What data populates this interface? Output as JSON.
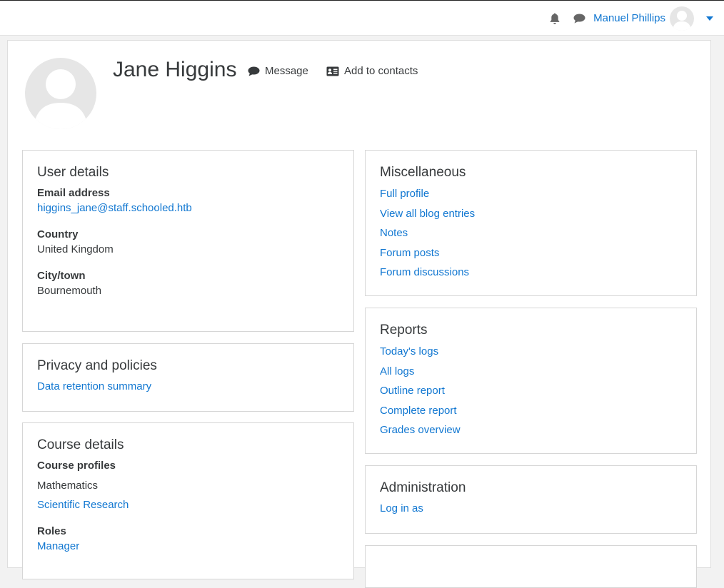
{
  "navbar": {
    "user_name": "Manuel Phillips"
  },
  "profile": {
    "name": "Jane Higgins",
    "message_label": "Message",
    "add_contacts_label": "Add to contacts"
  },
  "user_details": {
    "title": "User details",
    "email_label": "Email address",
    "email_value": "higgins_jane@staff.schooled.htb",
    "country_label": "Country",
    "country_value": "United Kingdom",
    "city_label": "City/town",
    "city_value": "Bournemouth"
  },
  "privacy": {
    "title": "Privacy and policies",
    "data_retention": "Data retention summary"
  },
  "course_details": {
    "title": "Course details",
    "profiles_label": "Course profiles",
    "profiles": [
      "Mathematics",
      "Scientific Research"
    ],
    "roles_label": "Roles",
    "roles_value": "Manager"
  },
  "misc": {
    "title": "Miscellaneous",
    "links": [
      "Full profile",
      "View all blog entries",
      "Notes",
      "Forum posts",
      "Forum discussions"
    ]
  },
  "reports": {
    "title": "Reports",
    "links": [
      "Today's logs",
      "All logs",
      "Outline report",
      "Complete report",
      "Grades overview"
    ]
  },
  "administration": {
    "title": "Administration",
    "login_as": "Log in as"
  },
  "colors": {
    "link": "#1177d1",
    "text": "#373a3c",
    "background": "#f2f2f2"
  }
}
